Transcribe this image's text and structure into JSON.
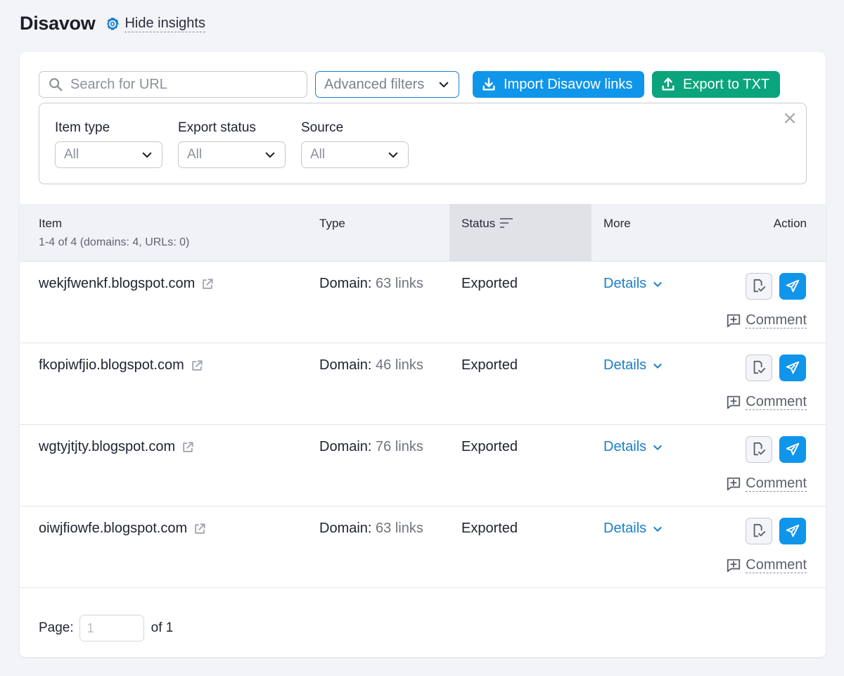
{
  "header": {
    "title": "Disavow",
    "insights_label": "Hide insights"
  },
  "toolbar": {
    "search_placeholder": "Search for URL",
    "advanced_filters_label": "Advanced filters",
    "import_label": "Import Disavow links",
    "export_label": "Export to TXT"
  },
  "filters": {
    "item_type": {
      "label": "Item type",
      "value": "All"
    },
    "export_status": {
      "label": "Export status",
      "value": "All"
    },
    "source": {
      "label": "Source",
      "value": "All"
    }
  },
  "table": {
    "headers": {
      "item": "Item",
      "item_sub": "1-4 of 4 (domains: 4, URLs: 0)",
      "type": "Type",
      "status": "Status",
      "more": "More",
      "action": "Action"
    },
    "rows": [
      {
        "item": "wekjfwenkf.blogspot.com",
        "type_label": "Domain:",
        "type_count": "63 links",
        "status": "Exported",
        "more": "Details",
        "comment": "Comment"
      },
      {
        "item": "fkopiwfjio.blogspot.com",
        "type_label": "Domain:",
        "type_count": "46 links",
        "status": "Exported",
        "more": "Details",
        "comment": "Comment"
      },
      {
        "item": "wgtyjtjty.blogspot.com",
        "type_label": "Domain:",
        "type_count": "76 links",
        "status": "Exported",
        "more": "Details",
        "comment": "Comment"
      },
      {
        "item": "oiwjfiowfe.blogspot.com",
        "type_label": "Domain:",
        "type_count": "63 links",
        "status": "Exported",
        "more": "Details",
        "comment": "Comment"
      }
    ]
  },
  "pager": {
    "label": "Page:",
    "placeholder": "1",
    "of_label": "of 1"
  },
  "colors": {
    "accent_blue": "#0f95ea",
    "accent_green": "#0aa57c",
    "link_blue": "#1a7fc9"
  },
  "icons": {
    "gear": "gear-icon",
    "search": "search-icon",
    "chevron": "chevron-down-icon",
    "download": "download-icon",
    "upload": "upload-icon",
    "close": "close-icon",
    "sort": "sort-icon",
    "external": "external-link-icon",
    "doc_check": "document-check-icon",
    "send": "send-icon",
    "comment": "comment-add-icon"
  }
}
